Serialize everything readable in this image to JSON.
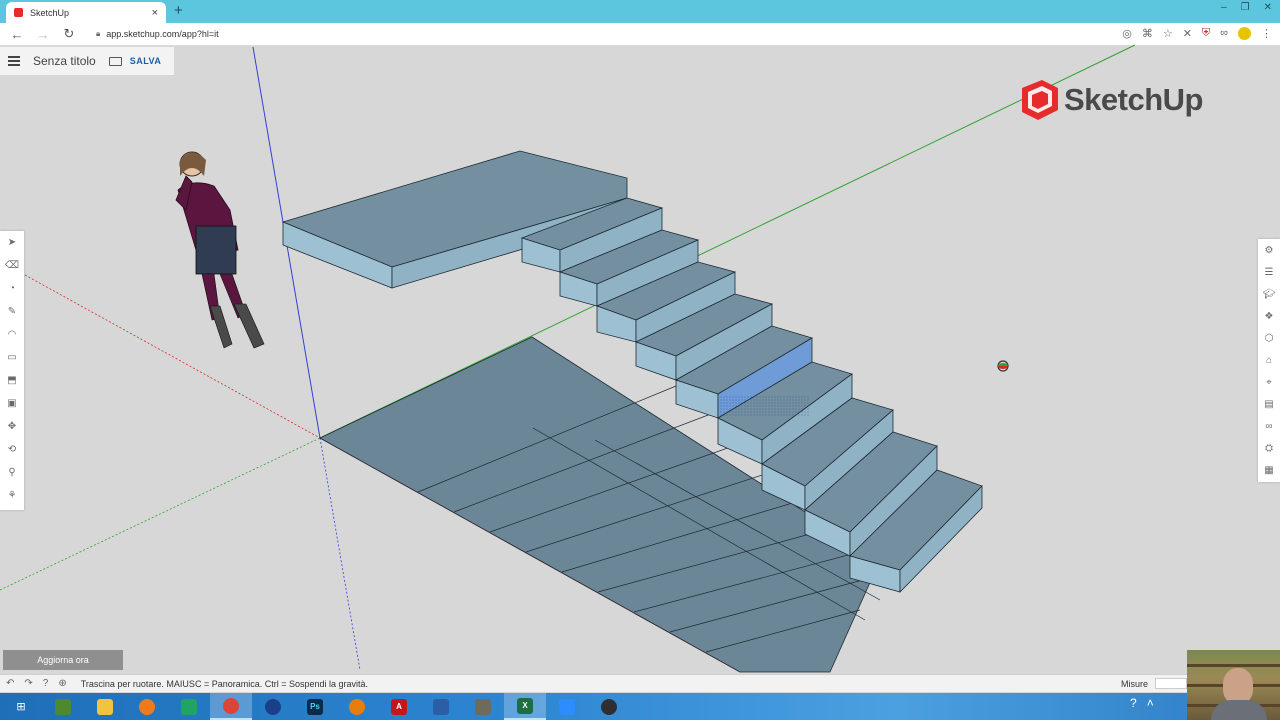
{
  "browser": {
    "tab_title": "SketchUp",
    "tab_close": "×",
    "new_tab": "+",
    "url": "app.sketchup.com/app?hl=it",
    "window_controls": [
      "–",
      "❐",
      "✕"
    ]
  },
  "app": {
    "document_title": "Senza titolo",
    "save_label": "SALVA",
    "logo_text": "SketchUp",
    "brand_color": "#e72b2c"
  },
  "left_toolbar": [
    "select",
    "eraser",
    "paint-bucket",
    "pencil",
    "arc",
    "rectangle",
    "push-pull",
    "move",
    "offset",
    "orbit",
    "tape-measure",
    "walk",
    "position-camera"
  ],
  "right_toolbar": [
    "entity-info",
    "outliner",
    "instructor",
    "components",
    "styles",
    "materials",
    "tags",
    "scenes",
    "shadows",
    "display",
    "solid-inspector",
    "extensions"
  ],
  "status": {
    "update_label": "Aggiorna ora",
    "hint_text": "Trascina per ruotare. MAIUSC = Panoramica. Ctrl = Sospendi la gravità.",
    "measurements_label": "Misure"
  },
  "taskbar": {
    "apps": [
      "start",
      "minecraft",
      "file-explorer",
      "firefox",
      "sheets",
      "chrome",
      "cinema4d",
      "photoshop",
      "blender",
      "acrobat",
      "virtualbox",
      "gimp",
      "excel",
      "zoom",
      "obs"
    ],
    "excel_letter": "X",
    "photoshop_letter": "Ps",
    "acrobat_letter": "A"
  }
}
